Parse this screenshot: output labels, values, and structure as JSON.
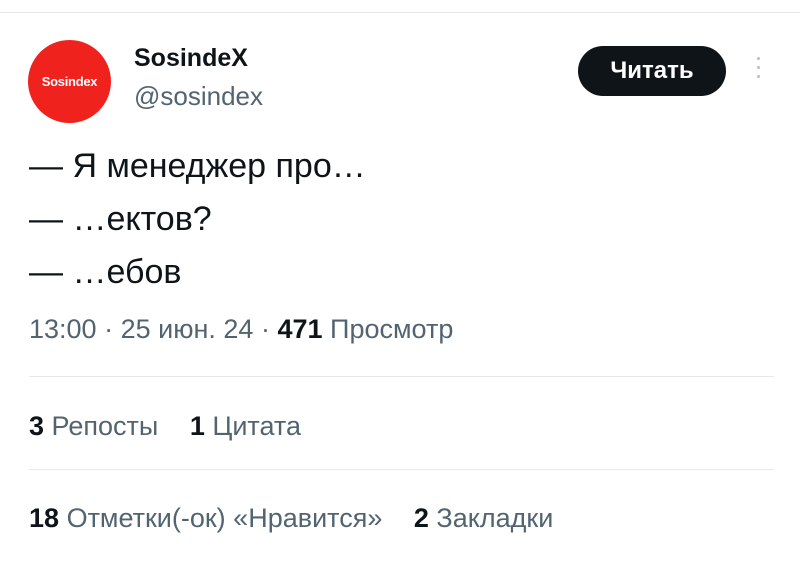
{
  "author": {
    "avatar_text": "Sosindex",
    "display_name": "SosindeX",
    "handle": "@sosindex"
  },
  "follow_label": "Читать",
  "tweet": {
    "lines": [
      "— Я менеджер про…",
      "— …ектов?",
      "— …ебов"
    ]
  },
  "meta": {
    "time": "13:00",
    "date": "25 июн. 24",
    "views_count": "471",
    "views_label": "Просмотр",
    "separator": "·"
  },
  "stats_row1": {
    "reposts_count": "3",
    "reposts_label": "Репосты",
    "quotes_count": "1",
    "quotes_label": "Цитата"
  },
  "stats_row2": {
    "likes_count": "18",
    "likes_label": "Отметки(-ок) «Нравится»",
    "bookmarks_count": "2",
    "bookmarks_label": "Закладки"
  },
  "colors": {
    "avatar_bg": "#f0221d",
    "button_bg": "#0f1419",
    "text_primary": "#0f1419",
    "text_secondary": "#536471"
  }
}
